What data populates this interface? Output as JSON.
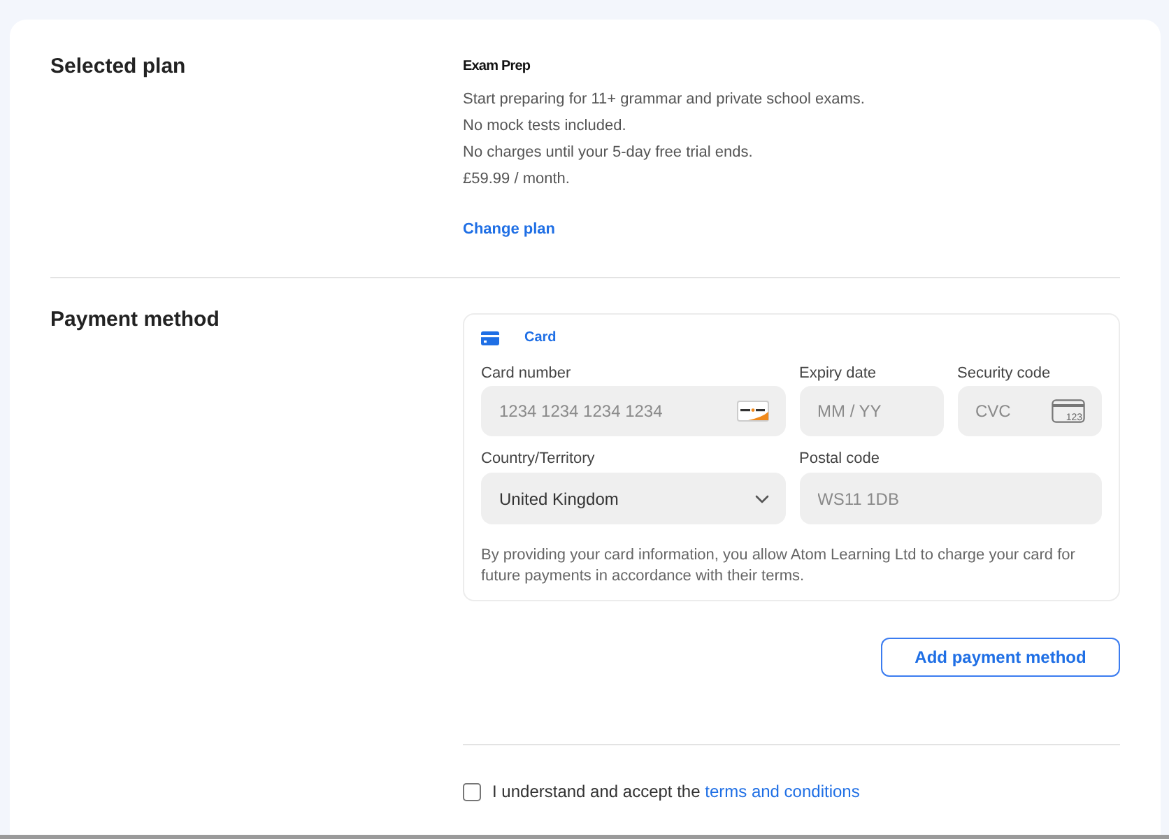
{
  "selected_plan": {
    "heading": "Selected plan",
    "plan_name": "Exam Prep",
    "details": [
      "Start preparing for 11+ grammar and private school exams.",
      "No mock tests included.",
      "No charges until your 5-day free trial ends.",
      "£59.99 / month."
    ],
    "change_link": "Change plan"
  },
  "payment_method": {
    "heading": "Payment method",
    "tabs": [
      {
        "label": "Card",
        "selected": true
      }
    ],
    "fields": [
      {
        "kind": "card_number",
        "label": "Card number",
        "placeholder": "1234 1234 1234 1234"
      },
      {
        "kind": "text",
        "label": "Expiry date",
        "placeholder": "MM / YY"
      },
      {
        "kind": "cvc",
        "label": "Security code",
        "placeholder": "CVC",
        "icon_label": "123"
      },
      {
        "kind": "select",
        "label": "Country/Territory",
        "value": "United Kingdom"
      },
      {
        "kind": "wide_text",
        "label": "Postal code",
        "placeholder": "WS11 1DB"
      }
    ],
    "disclaimer": "By providing your card information, you allow Atom Learning Ltd to charge your card for future payments in accordance with their terms.",
    "button": "Add payment method"
  },
  "terms": {
    "checked": false,
    "text": "I understand and accept the ",
    "link": "terms and conditions"
  }
}
